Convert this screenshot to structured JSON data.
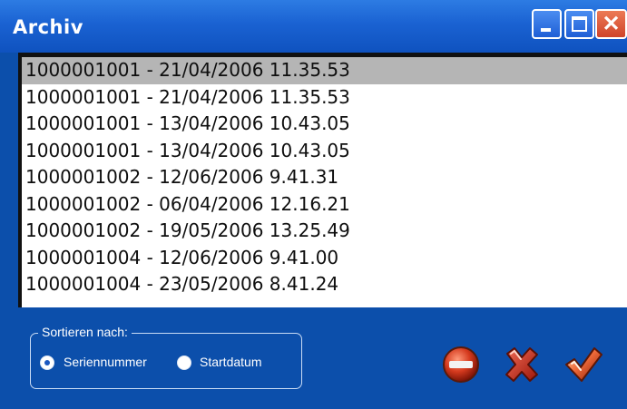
{
  "window": {
    "title": "Archiv"
  },
  "list": {
    "items": [
      {
        "label": "1000001001 - 21/04/2006 11.35.53",
        "selected": true
      },
      {
        "label": "1000001001 - 21/04/2006 11.35.53",
        "selected": false
      },
      {
        "label": "1000001001 - 13/04/2006 10.43.05",
        "selected": false
      },
      {
        "label": "1000001001 - 13/04/2006 10.43.05",
        "selected": false
      },
      {
        "label": "1000001002 - 12/06/2006 9.41.31",
        "selected": false
      },
      {
        "label": "1000001002 - 06/04/2006 12.16.21",
        "selected": false
      },
      {
        "label": "1000001002 - 19/05/2006 13.25.49",
        "selected": false
      },
      {
        "label": "1000001004 - 12/06/2006 9.41.00",
        "selected": false
      },
      {
        "label": "1000001004 - 23/05/2006 8.41.24",
        "selected": false
      }
    ]
  },
  "sort": {
    "legend": "Sortieren nach:",
    "options": [
      {
        "label": "Seriennummer",
        "checked": true
      },
      {
        "label": "Startdatum",
        "checked": false
      }
    ]
  },
  "actions": [
    {
      "icon": "delete-icon"
    },
    {
      "icon": "cancel-icon"
    },
    {
      "icon": "confirm-icon"
    }
  ],
  "colors": {
    "titlebar": "#1a62d2",
    "body": "#0c4fab",
    "selection": "#b5b5b5"
  }
}
